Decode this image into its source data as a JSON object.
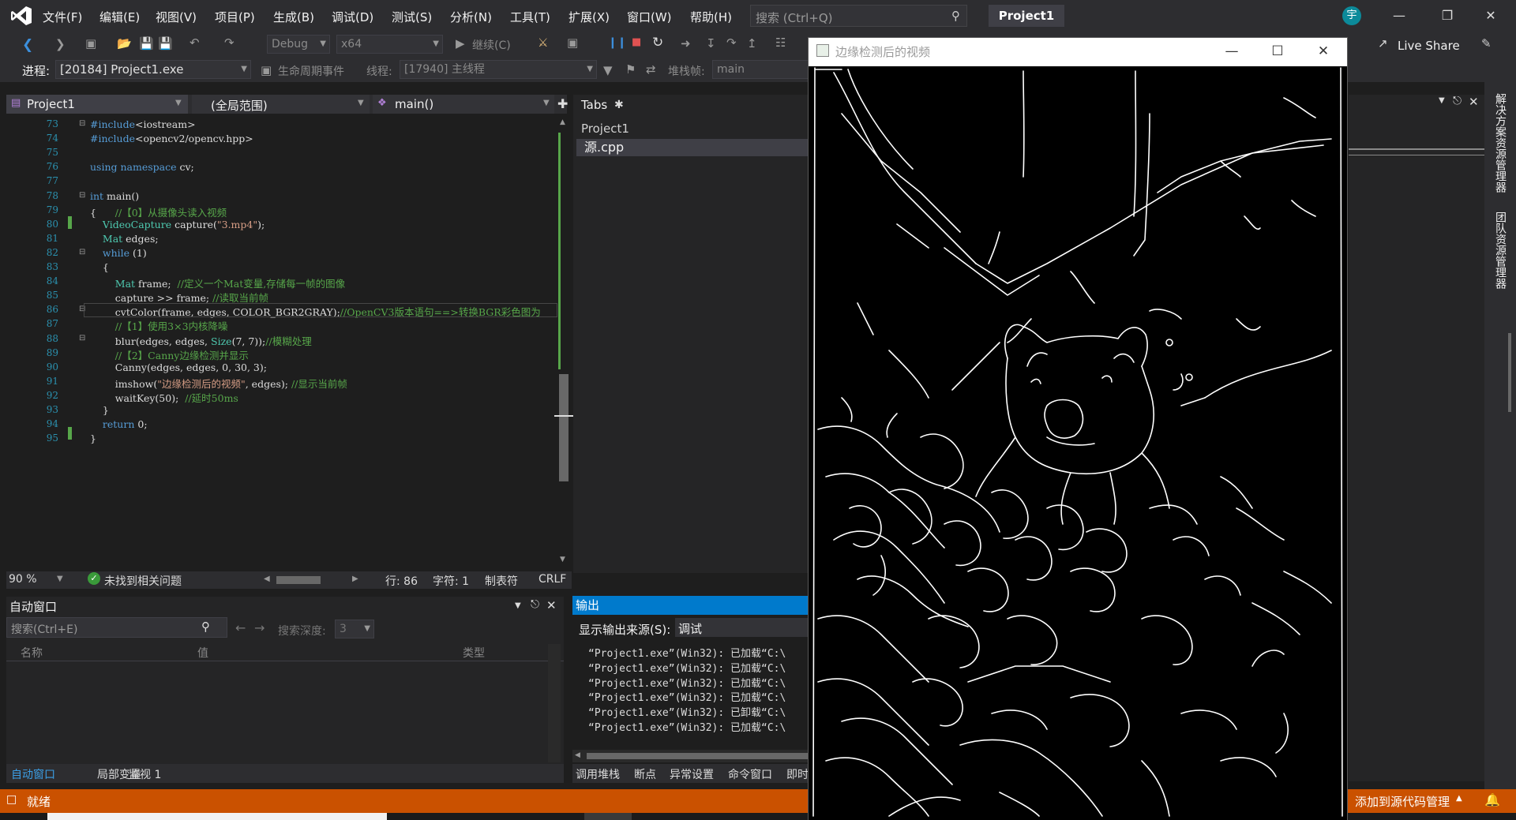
{
  "menu": [
    "文件(F)",
    "编辑(E)",
    "视图(V)",
    "项目(P)",
    "生成(B)",
    "调试(D)",
    "测试(S)",
    "分析(N)",
    "工具(T)",
    "扩展(X)",
    "窗口(W)",
    "帮助(H)"
  ],
  "search": {
    "placeholder": "搜索 (Ctrl+Q)"
  },
  "title": {
    "project": "Project1",
    "user": "宇"
  },
  "toolbar": {
    "config": "Debug",
    "platform": "x64",
    "continue": "继续(C)",
    "live_share": "Live Share"
  },
  "debugbar": {
    "process_label": "进程:",
    "process_value": "[20184] Project1.exe",
    "lifecycle": "生命周期事件",
    "thread_label": "线程:",
    "thread_value": "[17940] 主线程",
    "stackframe_label": "堆栈帧:",
    "stackframe_value": "main"
  },
  "editor": {
    "project_combo": "Project1",
    "scope_combo": "(全局范围)",
    "func_combo": "main()",
    "lines": [
      {
        "n": "73",
        "html": "<span class=\"kw\">#include</span>&lt;iostream&gt;"
      },
      {
        "n": "74",
        "html": "<span class=\"kw\">#include</span>&lt;opencv2/opencv.hpp&gt;"
      },
      {
        "n": "75",
        "html": ""
      },
      {
        "n": "76",
        "html": "<span class=\"kw\">using namespace</span> cv;"
      },
      {
        "n": "77",
        "html": ""
      },
      {
        "n": "78",
        "html": "<span class=\"kw\">int</span> main()"
      },
      {
        "n": "79",
        "html": "{      <span class=\"cm\">//【0】从摄像头读入视频</span>"
      },
      {
        "n": "80",
        "html": "    <span class=\"ty\">VideoCapture</span> capture(<span class=\"str\">\"3.mp4\"</span>);"
      },
      {
        "n": "81",
        "html": "    <span class=\"ty\">Mat</span> edges;"
      },
      {
        "n": "82",
        "html": "    <span class=\"kw\">while</span> (1)"
      },
      {
        "n": "83",
        "html": "    {"
      },
      {
        "n": "84",
        "html": "        <span class=\"ty\">Mat</span> frame;  <span class=\"cm\">//定义一个Mat变量,存储每一帧的图像</span>"
      },
      {
        "n": "85",
        "html": "        capture &gt;&gt; frame; <span class=\"cm\">//读取当前帧</span>"
      },
      {
        "n": "86",
        "html": "        cvtColor(frame, edges, COLOR_BGR2GRAY);<span class=\"cm\">//OpenCV3版本语句==&gt;转换BGR彩色图为</span>"
      },
      {
        "n": "87",
        "html": "        <span class=\"cm\">//【1】使用3×3内核降噪</span>"
      },
      {
        "n": "88",
        "html": "        blur(edges, edges, <span class=\"ty\">Size</span>(7, 7));<span class=\"cm\">//模糊处理</span>"
      },
      {
        "n": "89",
        "html": "        <span class=\"cm\">//【2】Canny边缘检测并显示</span>"
      },
      {
        "n": "90",
        "html": "        Canny(edges, edges, 0, 30, 3);"
      },
      {
        "n": "91",
        "html": "        imshow(<span class=\"str\">\"边缘检测后的视频\"</span>, edges); <span class=\"cm\">//显示当前帧</span>"
      },
      {
        "n": "92",
        "html": "        waitKey(50);  <span class=\"cm\">//延时50ms</span>"
      },
      {
        "n": "93",
        "html": "    }"
      },
      {
        "n": "94",
        "html": "    <span class=\"kw\">return</span> 0;"
      },
      {
        "n": "95",
        "html": "}"
      }
    ],
    "zoom": "90 %",
    "issues": "未找到相关问题",
    "row": "行: 86",
    "col": "字符: 1",
    "tab": "制表符",
    "eol": "CRLF"
  },
  "tabs_pane": {
    "title": "Tabs",
    "project": "Project1",
    "file": "源.cpp"
  },
  "autowin": {
    "title": "自动窗口",
    "search_placeholder": "搜索(Ctrl+E)",
    "depth_label": "搜索深度:",
    "depth_value": "3",
    "col_name": "名称",
    "col_value": "值",
    "col_type": "类型",
    "tabs": [
      "自动窗口",
      "局部变量",
      "监视 1"
    ]
  },
  "output": {
    "title": "输出",
    "source_label": "显示输出来源(S):",
    "source_value": "调试",
    "lines": [
      "“Project1.exe”(Win32): 已加载“C:\\",
      "“Project1.exe”(Win32): 已加载“C:\\",
      "“Project1.exe”(Win32): 已加载“C:\\",
      "“Project1.exe”(Win32): 已加载“C:\\",
      "“Project1.exe”(Win32): 已卸载“C:\\",
      "“Project1.exe”(Win32): 已加载“C:\\"
    ],
    "tabs": [
      "调用堆栈",
      "断点",
      "异常设置",
      "命令窗口",
      "即时"
    ]
  },
  "right_strip": [
    "解决方案资源管理器",
    "团队资源管理器"
  ],
  "status": {
    "ready": "就绪",
    "source_control": "添加到源代码管理"
  },
  "video_window": {
    "title": "边缘检测后的视频"
  },
  "colors": {
    "accent": "#007acc",
    "status": "#ca5100",
    "title_bg": "#2d2d30"
  }
}
